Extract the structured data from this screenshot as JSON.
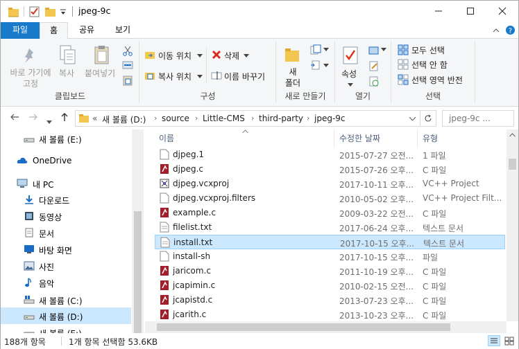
{
  "window": {
    "title": "jpeg-9c",
    "colors": {
      "accent": "#1979ca",
      "selection": "#cce8ff",
      "selection_border": "#99d1ff"
    }
  },
  "ribbon_tabs": [
    "파일",
    "홈",
    "공유",
    "보기"
  ],
  "ribbon": {
    "clipboard": {
      "pin": "바로 가기에\n고정",
      "copy": "복사",
      "paste": "붙여넣기",
      "label": "클립보드"
    },
    "organize": {
      "move_to": "이동 위치",
      "copy_to": "복사 위치",
      "delete": "삭제",
      "rename": "이름 바꾸기",
      "label": "구성"
    },
    "new": {
      "new_folder": "새\n폴더",
      "label": "새로 만들기"
    },
    "open": {
      "properties": "속성",
      "label": "열기"
    },
    "select": {
      "select_all": "모두 선택",
      "select_none": "선택 안 함",
      "invert": "선택 영역 반전",
      "label": "선택"
    }
  },
  "address": {
    "prefix": "«",
    "crumbs": [
      "새 볼륨 (D:)",
      "source",
      "Little-CMS",
      "third-party",
      "jpeg-9c"
    ],
    "search_placeholder": "jpeg-9c ..."
  },
  "nav_items": [
    {
      "label": "새 볼륨 (E:)",
      "icon": "drive-icon"
    },
    {
      "label": "OneDrive",
      "icon": "cloud-icon"
    },
    {
      "label": "내 PC",
      "icon": "pc-icon"
    },
    {
      "label": "다운로드",
      "icon": "download-icon"
    },
    {
      "label": "동영상",
      "icon": "video-icon"
    },
    {
      "label": "문서",
      "icon": "document-icon"
    },
    {
      "label": "바탕 화면",
      "icon": "desktop-icon"
    },
    {
      "label": "사진",
      "icon": "picture-icon"
    },
    {
      "label": "음악",
      "icon": "music-icon"
    },
    {
      "label": "새 볼륨 (C:)",
      "icon": "drive-icon"
    },
    {
      "label": "새 볼륨 (D:)",
      "icon": "drive-icon"
    },
    {
      "label": "새 볼륨 (E:)",
      "icon": "drive-icon"
    }
  ],
  "columns": {
    "name": "이름",
    "date": "수정한 날짜",
    "type": "유형"
  },
  "files": [
    {
      "name": "djpeg.1",
      "date": "2015-07-27 오전...",
      "type": "1 파일",
      "icon": "blank-file-icon"
    },
    {
      "name": "djpeg.c",
      "date": "2015-07-26 오후...",
      "type": "C 파일",
      "icon": "c-file-icon"
    },
    {
      "name": "djpeg.vcxproj",
      "date": "2017-10-11 오후...",
      "type": "VC++ Project",
      "icon": "vcxproj-icon"
    },
    {
      "name": "djpeg.vcxproj.filters",
      "date": "2010-05-02 오후...",
      "type": "VC++ Project Filt...",
      "icon": "blank-file-icon"
    },
    {
      "name": "example.c",
      "date": "2009-03-22 오전...",
      "type": "C 파일",
      "icon": "c-file-icon"
    },
    {
      "name": "filelist.txt",
      "date": "2017-06-24 오후...",
      "type": "텍스트 문서",
      "icon": "text-file-icon"
    },
    {
      "name": "install.txt",
      "date": "2017-10-15 오후...",
      "type": "텍스트 문서",
      "icon": "text-file-icon"
    },
    {
      "name": "install-sh",
      "date": "2017-10-15 오후...",
      "type": "파일",
      "icon": "blank-file-icon"
    },
    {
      "name": "jaricom.c",
      "date": "2011-10-19 오후...",
      "type": "C 파일",
      "icon": "c-file-icon"
    },
    {
      "name": "jcapimin.c",
      "date": "2010-02-15 오전...",
      "type": "C 파일",
      "icon": "c-file-icon"
    },
    {
      "name": "jcapistd.c",
      "date": "2013-07-23 오후...",
      "type": "C 파일",
      "icon": "c-file-icon"
    },
    {
      "name": "jcarith.c",
      "date": "2013-10-23 오후...",
      "type": "C 파일",
      "icon": "c-file-icon"
    }
  ],
  "status": {
    "count": "188개 항목",
    "selection": "1개 항목 선택함 53.6KB"
  }
}
